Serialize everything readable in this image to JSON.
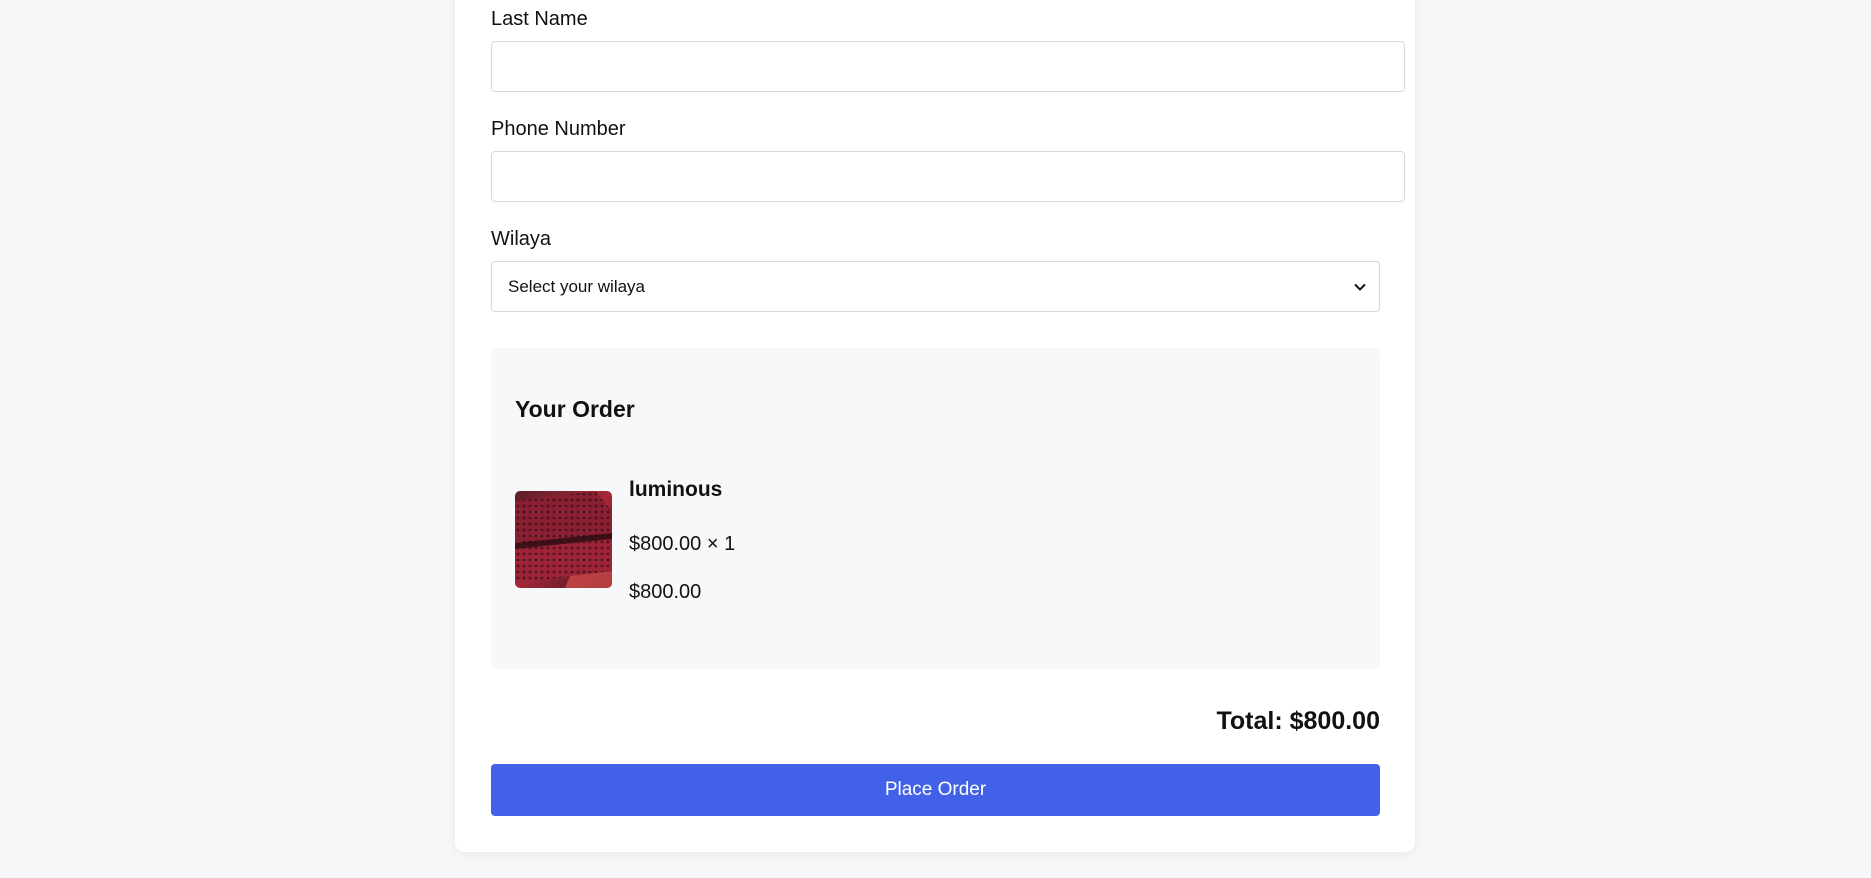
{
  "form": {
    "last_name": {
      "label": "Last Name",
      "value": ""
    },
    "phone": {
      "label": "Phone Number",
      "value": ""
    },
    "wilaya": {
      "label": "Wilaya",
      "selected": "Select your wilaya"
    }
  },
  "order": {
    "title": "Your Order",
    "items": [
      {
        "name": "luminous",
        "price_qty": "$800.00 × 1",
        "subtotal": "$800.00",
        "thumbnail_icon": "product-photo"
      }
    ]
  },
  "total_label": "Total: $800.00",
  "place_order_label": "Place Order",
  "colors": {
    "accent": "#4361e8",
    "page_bg": "#f6f7f9",
    "card_bg": "#ffffff",
    "order_box_bg": "#f7f8fa"
  }
}
